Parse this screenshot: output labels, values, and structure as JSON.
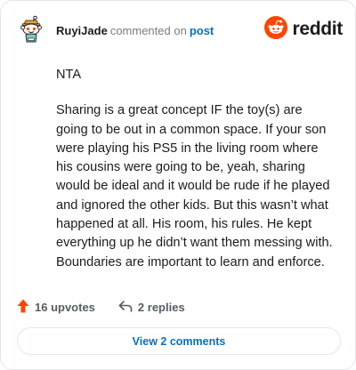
{
  "comment": {
    "username": "RuyiJade",
    "verb": "commented on",
    "target": "post",
    "avatar_icon": "snoo-avatar-icon",
    "paragraphs": [
      "NTA",
      "Sharing is a great concept IF the toy(s) are going to be out in a common space. If your son were playing his PS5 in the living room where his cousins were going to be, yeah, sharing would be ideal and it would be rude if he played and ignored the other kids. But this wasn’t what happened at all. His room, his rules. He kept everything up he didn’t want them messing with. Boundaries are important to learn and enforce."
    ]
  },
  "brand": {
    "name": "reddit",
    "icon": "reddit-logo-icon",
    "color": "#ff4500"
  },
  "actions": {
    "upvotes_label": "16 upvotes",
    "upvote_icon": "upvote-arrow-icon",
    "upvote_color": "#ff4500",
    "replies_label": "2 replies",
    "reply_icon": "reply-arrow-icon"
  },
  "footer": {
    "view_comments_label": "View 2 comments",
    "link_color": "#0a6ec2"
  }
}
